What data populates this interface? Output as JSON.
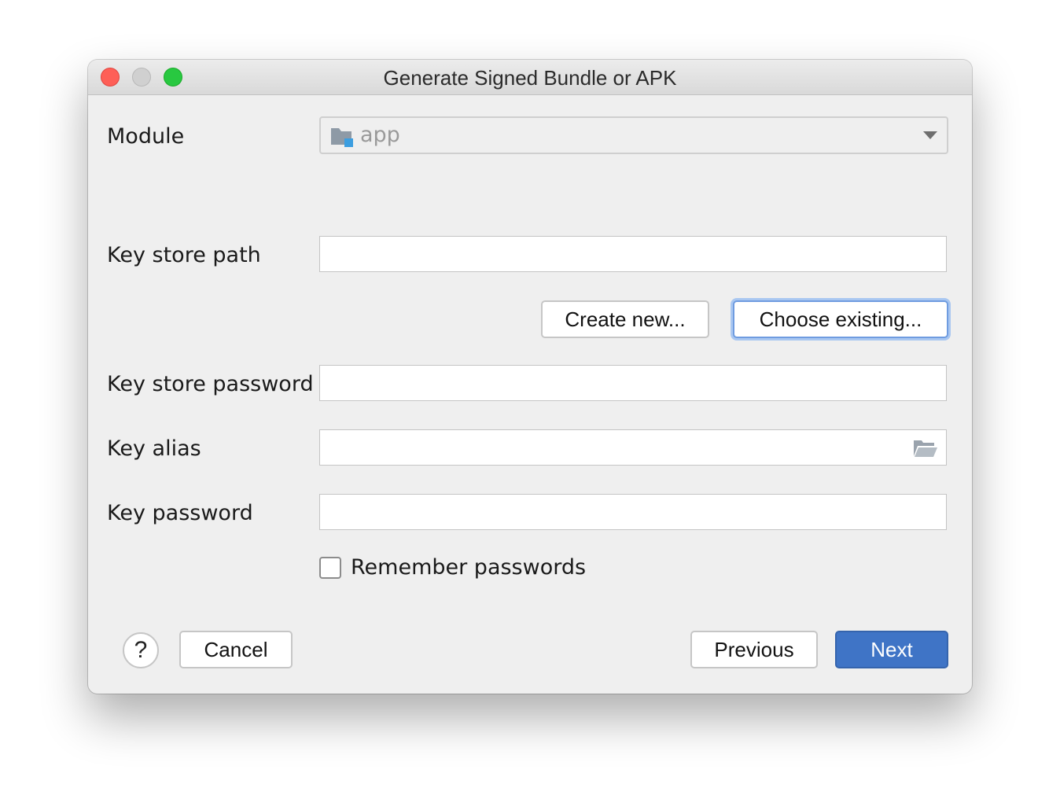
{
  "window": {
    "title": "Generate Signed Bundle or APK"
  },
  "module": {
    "label": "Module",
    "value": "app",
    "icon": "module-folder-icon"
  },
  "key_store_path": {
    "label": "Key store path",
    "value": ""
  },
  "key_store_buttons": {
    "create_new": "Create new...",
    "choose_existing": "Choose existing..."
  },
  "key_store_password": {
    "label": "Key store password",
    "value": ""
  },
  "key_alias": {
    "label": "Key alias",
    "value": "",
    "icon": "open-folder-icon"
  },
  "key_password": {
    "label": "Key password",
    "value": ""
  },
  "remember_passwords": {
    "label": "Remember passwords",
    "checked": false
  },
  "footer": {
    "help": "?",
    "cancel": "Cancel",
    "previous": "Previous",
    "next": "Next"
  },
  "colors": {
    "accent": "#3f74c6",
    "close": "#fe5f57",
    "minimize_disabled": "#d0d0d0",
    "maximize": "#28c840",
    "focus_ring": "#a9c7f1"
  }
}
